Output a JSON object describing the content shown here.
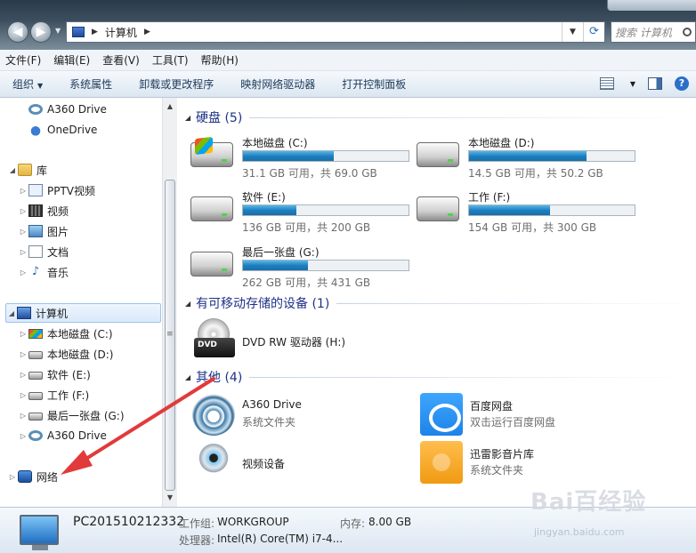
{
  "address": {
    "path": "计算机"
  },
  "search": {
    "placeholder": "搜索 计算机"
  },
  "menu": [
    "文件(F)",
    "编辑(E)",
    "查看(V)",
    "工具(T)",
    "帮助(H)"
  ],
  "commands": {
    "organize": "组织",
    "sysprops": "系统属性",
    "uninstall": "卸载或更改程序",
    "mapdrive": "映射网络驱动器",
    "controlpanel": "打开控制面板"
  },
  "sidebar": {
    "a360": "A360 Drive",
    "onedrive": "OneDrive",
    "library": "库",
    "pptv": "PPTV视频",
    "video": "视频",
    "pictures": "图片",
    "docs": "文档",
    "music": "音乐",
    "computer": "计算机",
    "c": "本地磁盘 (C:)",
    "d": "本地磁盘 (D:)",
    "e": "软件 (E:)",
    "f": "工作 (F:)",
    "g": "最后一张盘 (G:)",
    "a360b": "A360 Drive",
    "network": "网络"
  },
  "groups": {
    "hdd": "硬盘 (5)",
    "removable": "有可移动存储的设备 (1)",
    "other": "其他 (4)"
  },
  "drives": [
    {
      "name": "本地磁盘 (C:)",
      "info": "31.1 GB 可用，共 69.0 GB",
      "used": 0.55
    },
    {
      "name": "本地磁盘 (D:)",
      "info": "14.5 GB 可用，共 50.2 GB",
      "used": 0.71
    },
    {
      "name": "软件 (E:)",
      "info": "136 GB 可用，共 200 GB",
      "used": 0.32
    },
    {
      "name": "工作 (F:)",
      "info": "154 GB 可用，共 300 GB",
      "used": 0.49
    },
    {
      "name": "最后一张盘 (G:)",
      "info": "262 GB 可用，共 431 GB",
      "used": 0.39
    }
  ],
  "dvd": {
    "name": "DVD RW 驱动器 (H:)",
    "badge": "DVD"
  },
  "others": [
    {
      "name": "A360 Drive",
      "sub": "系统文件夹"
    },
    {
      "name": "百度网盘",
      "sub": "双击运行百度网盘"
    },
    {
      "name": "视频设备",
      "sub": ""
    },
    {
      "name": "迅雷影音片库",
      "sub": "系统文件夹"
    }
  ],
  "details": {
    "pc_name": "PC201510212332",
    "workgroup_label": "工作组:",
    "workgroup": "WORKGROUP",
    "memory_label": "内存:",
    "memory": "8.00 GB",
    "cpu_label": "处理器:",
    "cpu": "Intel(R) Core(TM) i7-4..."
  },
  "watermark": {
    "brand": "Bai百经验",
    "url": "jingyan.baidu.com"
  },
  "colors": {
    "accent": "#1e3287",
    "arrow": "#e23a3a",
    "bar": "#1d7fc1"
  }
}
